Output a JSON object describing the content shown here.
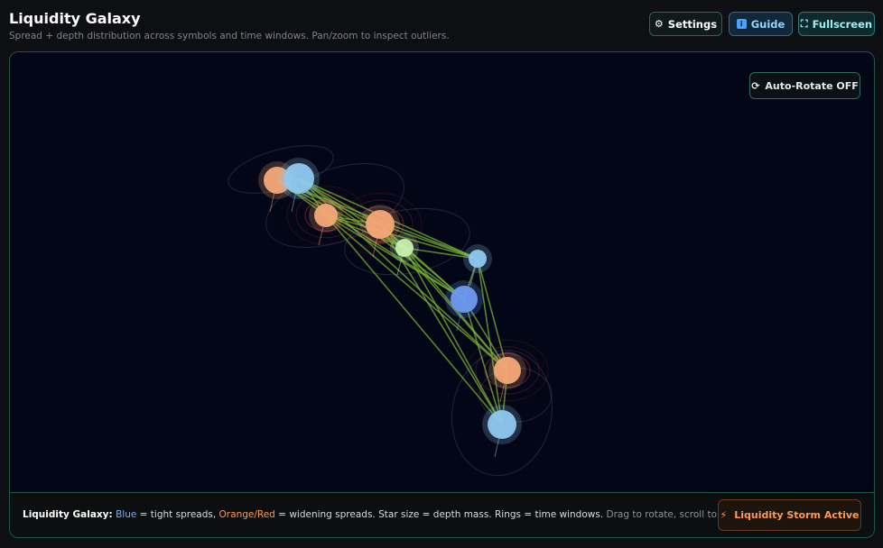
{
  "app": {
    "title": "Liquidity Galaxy",
    "subtitle": "Spread + depth distribution across symbols and time windows. Pan/zoom to inspect outliers."
  },
  "toolbar": {
    "settings_label": "Settings",
    "settings_icon": "gear-icon",
    "guide_label": "Guide",
    "guide_icon": "info-icon",
    "fullscreen_label": "Fullscreen",
    "fullscreen_icon": "expand-icon"
  },
  "canvas": {
    "auto_rotate_label": "Auto-Rotate OFF",
    "auto_rotate_icon": "rotate-icon"
  },
  "footer": {
    "legend_title": "Liquidity Galaxy:",
    "legend_blue": "Blue",
    "legend_blue_desc": " = tight spreads, ",
    "legend_orange": "Orange/Red",
    "legend_orange_desc": " = widening spreads. Star size = depth mass. Rings = time windows.",
    "legend_hint": " Drag to rotate, scroll to zoom.",
    "storm_label": "Liquidity Storm Active",
    "storm_icon": "lightning-icon"
  },
  "colors": {
    "tight": "#8fc8ee",
    "tight_deep": "#6f9af0",
    "widening": "#f4a878",
    "mid": "#c8efb0",
    "link": "#8cd03a",
    "ring_red": "#c0303c"
  }
}
